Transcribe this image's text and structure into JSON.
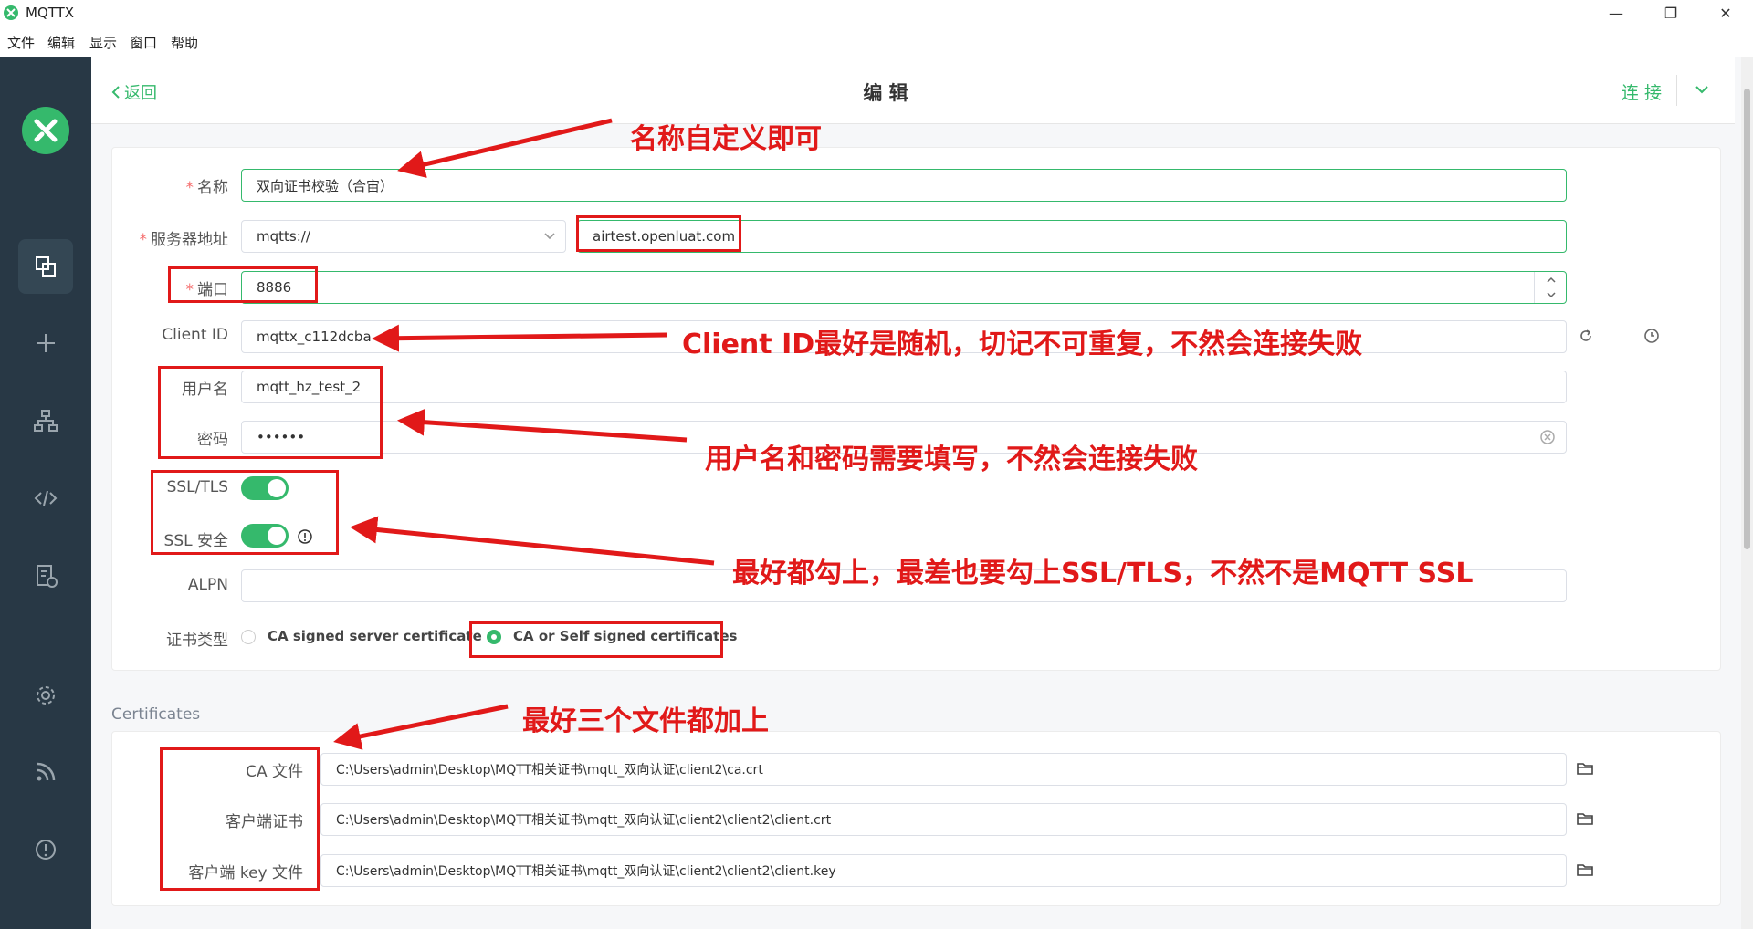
{
  "window": {
    "title": "MQTTX"
  },
  "menu": [
    "文件",
    "编辑",
    "显示",
    "窗口",
    "帮助"
  ],
  "header": {
    "back": "返回",
    "title": "编 辑",
    "connect": "连 接"
  },
  "section": {
    "certificates": "Certificates"
  },
  "form": {
    "name": {
      "label": "名称",
      "value": "双向证书校验（合宙）"
    },
    "host": {
      "label": "服务器地址",
      "protocol": "mqtts://",
      "value": "airtest.openluat.com"
    },
    "port": {
      "label": "端口",
      "value": "8886"
    },
    "client_id": {
      "label": "Client ID",
      "value": "mqttx_c112dcba"
    },
    "username": {
      "label": "用户名",
      "value": "mqtt_hz_test_2"
    },
    "password": {
      "label": "密码",
      "value": "••••••"
    },
    "ssl_tls": {
      "label": "SSL/TLS",
      "on": true
    },
    "ssl_secure": {
      "label": "SSL 安全",
      "on": true
    },
    "alpn": {
      "label": "ALPN",
      "value": ""
    },
    "cert_type": {
      "label": "证书类型",
      "options": [
        "CA signed server certificate",
        "CA or Self signed certificates"
      ],
      "selected": 1
    }
  },
  "certs": {
    "ca": {
      "label": "CA 文件",
      "value": "C:\\Users\\admin\\Desktop\\MQTT相关证书\\mqtt_双向认证\\client2\\ca.crt"
    },
    "client_cert": {
      "label": "客户端证书",
      "value": "C:\\Users\\admin\\Desktop\\MQTT相关证书\\mqtt_双向认证\\client2\\client2\\client.crt"
    },
    "client_key": {
      "label": "客户端 key 文件",
      "value": "C:\\Users\\admin\\Desktop\\MQTT相关证书\\mqtt_双向认证\\client2\\client2\\client.key"
    }
  },
  "annotations": {
    "name": "名称自定义即可",
    "client_id": "Client ID最好是随机，切记不可重复，不然会连接失败",
    "credentials": "用户名和密码需要填写，不然会连接失败",
    "ssl": "最好都勾上，最差也要勾上SSL/TLS，不然不是MQTT SSL",
    "files": "最好三个文件都加上"
  },
  "colors": {
    "accent": "#35b96c",
    "sidebar": "#283845",
    "annotation": "#e11919"
  }
}
